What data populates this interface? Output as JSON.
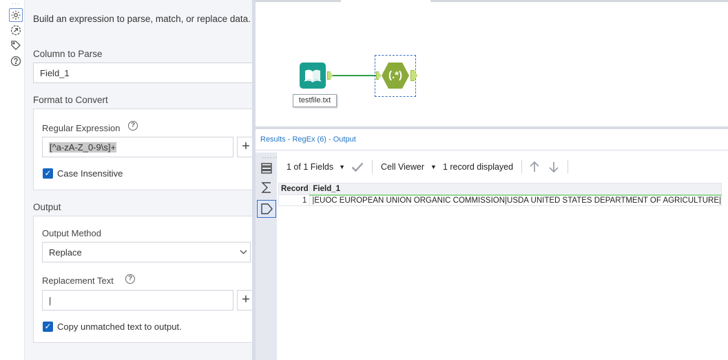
{
  "config": {
    "description": "Build an expression to parse, match, or replace data.",
    "column_to_parse_label": "Column to Parse",
    "column_to_parse_value": "Field_1",
    "format_to_convert_label": "Format to Convert",
    "regex_label": "Regular Expression",
    "regex_value": "[^a-zA-Z_0-9\\s]+",
    "case_insensitive_label": "Case Insensitive",
    "output_label": "Output",
    "output_method_label": "Output Method",
    "output_method_value": "Replace",
    "replacement_text_label": "Replacement Text",
    "replacement_text_value": "|",
    "copy_unmatched_label": "Copy unmatched text to output.",
    "help_glyph": "?",
    "plus_glyph": "+"
  },
  "canvas": {
    "input_tool_label": "testfile.txt",
    "regex_tool_glyph": "(.*)"
  },
  "results": {
    "title": "Results - RegEx (6) - Output",
    "fields_selector": "1 of 1 Fields",
    "cell_viewer": "Cell Viewer",
    "records_displayed": "1 record displayed",
    "columns": [
      "Record",
      "Field_1"
    ],
    "rows": [
      {
        "record": "1",
        "field_1": "|EUOC EUROPEAN UNION ORGANIC COMMISSION|USDA UNITED STATES DEPARTMENT OF AGRICULTURE|"
      }
    ]
  },
  "colors": {
    "accent_blue": "#1565c0",
    "tool_teal": "#1a9e8f",
    "regex_green": "#8aab3a",
    "connector_green": "#2e9e44"
  }
}
